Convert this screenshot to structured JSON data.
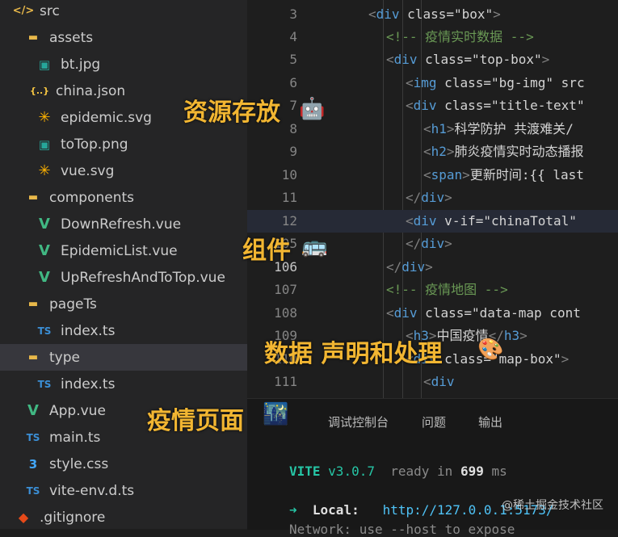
{
  "explorer": {
    "items": [
      {
        "label": "src",
        "icon": "folder-source-icon",
        "glyph": "</>"
      },
      {
        "label": "assets",
        "icon": "folder-icon",
        "glyph": "▬"
      },
      {
        "label": "bt.jpg",
        "icon": "image-icon",
        "glyph": "▣"
      },
      {
        "label": "china.json",
        "icon": "json-icon",
        "glyph": "{..}"
      },
      {
        "label": "epidemic.svg",
        "icon": "svg-icon",
        "glyph": "✳"
      },
      {
        "label": "toTop.png",
        "icon": "image-icon",
        "glyph": "▣"
      },
      {
        "label": "vue.svg",
        "icon": "svg-icon",
        "glyph": "✳"
      },
      {
        "label": "components",
        "icon": "folder-components-icon",
        "glyph": "▬"
      },
      {
        "label": "DownRefresh.vue",
        "icon": "vue-file-icon",
        "glyph": "V"
      },
      {
        "label": "EpidemicList.vue",
        "icon": "vue-file-icon",
        "glyph": "V"
      },
      {
        "label": "UpRefreshAndToTop.vue",
        "icon": "vue-file-icon",
        "glyph": "V"
      },
      {
        "label": "pageTs",
        "icon": "folder-icon",
        "glyph": "▬"
      },
      {
        "label": "index.ts",
        "icon": "typescript-icon",
        "glyph": "TS"
      },
      {
        "label": "type",
        "icon": "folder-icon",
        "glyph": "▬"
      },
      {
        "label": "index.ts",
        "icon": "typescript-icon",
        "glyph": "TS"
      },
      {
        "label": "App.vue",
        "icon": "vue-file-icon",
        "glyph": "V"
      },
      {
        "label": "main.ts",
        "icon": "typescript-icon",
        "glyph": "TS"
      },
      {
        "label": "style.css",
        "icon": "css-icon",
        "glyph": "3"
      },
      {
        "label": "vite-env.d.ts",
        "icon": "typescript-icon",
        "glyph": "TS"
      },
      {
        "label": ".gitignore",
        "icon": "git-icon",
        "glyph": "◆"
      }
    ]
  },
  "editor": {
    "lines": [
      {
        "num": "3",
        "code": "<div class=\"box\">"
      },
      {
        "num": "4",
        "code": "<!-- 疫情实时数据 -->"
      },
      {
        "num": "5",
        "code": "<div class=\"top-box\">"
      },
      {
        "num": "6",
        "code": "<img class=\"bg-img\" src"
      },
      {
        "num": "7",
        "code": "<div class=\"title-text\""
      },
      {
        "num": "8",
        "code": "<h1>科学防护 共渡难关</"
      },
      {
        "num": "9",
        "code": "<h2>肺炎疫情实时动态播报"
      },
      {
        "num": "10",
        "code": "<span>更新时间:{{ last"
      },
      {
        "num": "11",
        "code": "</div>"
      },
      {
        "num": "12",
        "code": "<div v-if=\"chinaTotal\""
      },
      {
        "num": "105",
        "code": "</div>"
      },
      {
        "num": "106",
        "code": "</div>"
      },
      {
        "num": "107",
        "code": "<!-- 疫情地图 -->"
      },
      {
        "num": "108",
        "code": "<div class=\"data-map cont"
      },
      {
        "num": "109",
        "code": "<h3>中国疫情</h3>"
      },
      {
        "num": "110",
        "code": "<div class=\"map-box\">"
      },
      {
        "num": "111",
        "code": "<div"
      }
    ]
  },
  "panel": {
    "tabs": [
      "调试控制台",
      "问题",
      "输出"
    ],
    "terminal": {
      "vite_name": "VITE",
      "vite_version": "v3.0.7",
      "ready_text": "ready in",
      "ready_ms": "699",
      "ready_unit": "ms",
      "local_arrow": "➜",
      "local_label": "Local:",
      "local_url": "http://127.0.0.1:5173/",
      "network_text": "Network: use --host to expose"
    }
  },
  "annotations": {
    "assets": "资源存放",
    "components": "组件",
    "types": "数据 声明和处理",
    "app": "疫情页面"
  },
  "watermark": "@稀土掘金技术社区",
  "colors": {
    "sidebar_bg": "#252526",
    "editor_bg": "#1e1e1e",
    "annotation": "#f2b632",
    "tag": "#569cd6",
    "attr": "#9cdcfe",
    "string": "#ce9178",
    "comment": "#6a9955",
    "vite": "#26c6a6"
  }
}
